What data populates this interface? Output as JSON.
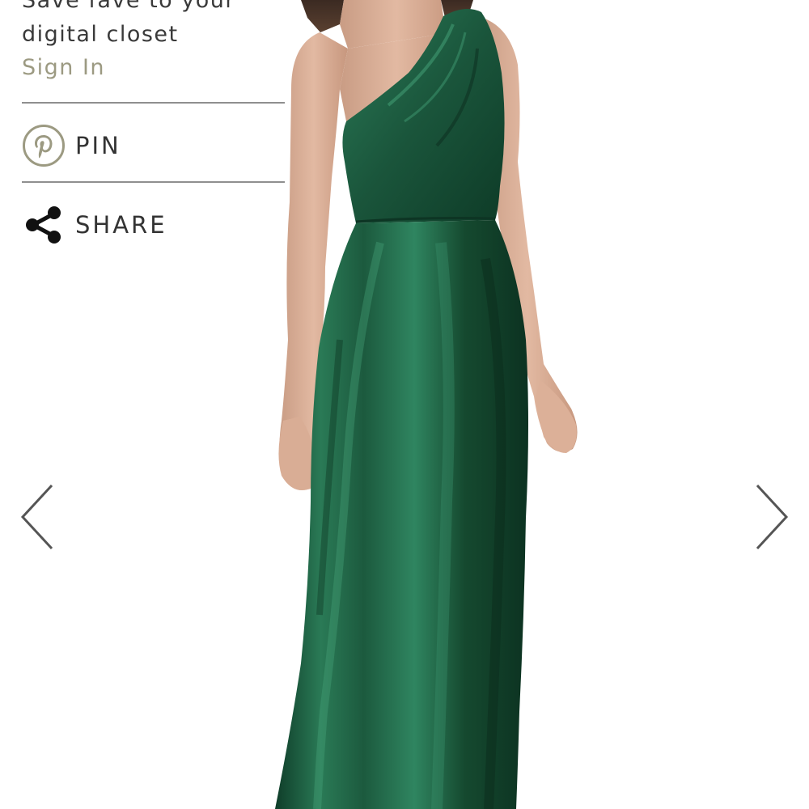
{
  "favorites": {
    "prompt_line1": "Save fave to your",
    "prompt_line2": "digital closet",
    "sign_in_label": "Sign In"
  },
  "actions": {
    "pin_label": "PIN",
    "share_label": "SHARE"
  },
  "product": {
    "image_alt": "One-shoulder satin maxi dress in emerald green"
  },
  "colors": {
    "dress": "#1c5a3e",
    "accent_signin": "#9c9a82",
    "text": "#333333",
    "divider": "#8f8f8f"
  },
  "icons": {
    "pin": "pinterest-icon",
    "share": "share-icon",
    "prev": "chevron-left-icon",
    "next": "chevron-right-icon"
  }
}
